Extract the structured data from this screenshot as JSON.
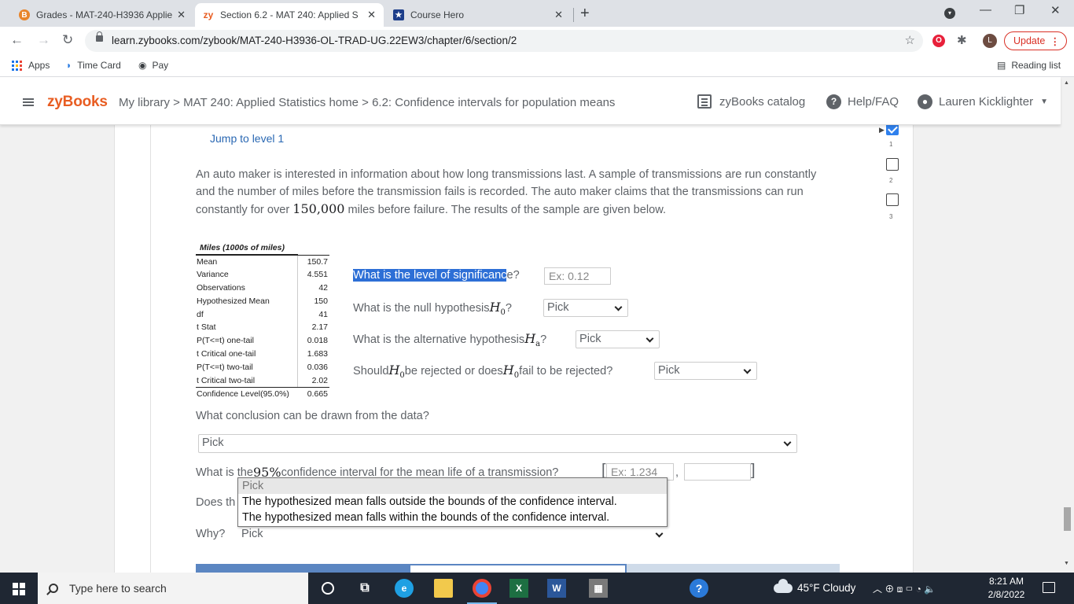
{
  "browser": {
    "tabs": [
      {
        "title": "Grades - MAT-240-H3936 Applie",
        "favicon": "B",
        "favicon_color": "#e8852b",
        "close": "✕"
      },
      {
        "title": "Section 6.2 - MAT 240: Applied S",
        "favicon": "zy",
        "favicon_color": "#e85d22",
        "close": "✕"
      },
      {
        "title": "Course Hero",
        "favicon": "★",
        "favicon_color": "#1d3e8a",
        "close": "✕"
      }
    ],
    "new_tab": "+",
    "url": "learn.zybooks.com/zybook/MAT-240-H3936-OL-TRAD-UG.22EW3/chapter/6/section/2",
    "profile_initial": "L",
    "update_label": "Update",
    "bookmarks": [
      {
        "label": "Apps"
      },
      {
        "label": "Time Card"
      },
      {
        "label": "Pay"
      }
    ],
    "reading_list": "Reading list"
  },
  "zybooks": {
    "logo": "zyBooks",
    "breadcrumb": "My library > MAT 240: Applied Statistics home > 6.2: Confidence intervals for population means",
    "catalog": "zyBooks catalog",
    "help": "Help/FAQ",
    "user": "Lauren Kicklighter"
  },
  "activity": {
    "jump_link": "Jump to level 1",
    "problem_text_1": "An auto maker is interested in information about how long transmissions last. A sample of transmissions are run constantly and the number of miles before the transmission fails is recorded. The auto maker claims that the transmissions can run constantly for over ",
    "problem_number": "150,000",
    "problem_text_2": " miles before failure. The results of the sample are given below.",
    "levels": [
      {
        "num": "1",
        "done": true
      },
      {
        "num": "2",
        "done": false
      },
      {
        "num": "3",
        "done": false
      }
    ],
    "table": {
      "header": "Miles (1000s of miles)",
      "rows": [
        {
          "k": "Mean",
          "v": "150.7"
        },
        {
          "k": "Variance",
          "v": "4.551"
        },
        {
          "k": "Observations",
          "v": "42"
        },
        {
          "k": "Hypothesized Mean",
          "v": "150"
        },
        {
          "k": "df",
          "v": "41"
        },
        {
          "k": "t Stat",
          "v": "2.17"
        },
        {
          "k": "P(T<=t) one-tail",
          "v": "0.018"
        },
        {
          "k": "t Critical one-tail",
          "v": "1.683"
        },
        {
          "k": "P(T<=t) two-tail",
          "v": "0.036"
        },
        {
          "k": "t Critical two-tail",
          "v": "2.02"
        },
        {
          "k": "Confidence Level(95.0%)",
          "v": "0.665"
        }
      ]
    },
    "q1_highlight": "What is the level of significanc",
    "q1_rest": "e?",
    "q1_placeholder": "Ex: 0.12",
    "q2_a": "What is the null hypothesis ",
    "q2_var": "H",
    "q2_sub": "0",
    "q2_end": "?",
    "q3_a": "What is the alternative hypothesis ",
    "q3_var": "H",
    "q3_sub": "a",
    "q3_end": "?",
    "q4_a": "Should ",
    "q4_b": " be rejected or does ",
    "q4_c": " fail to be rejected?",
    "q5": "What conclusion can be drawn from the data?",
    "q6_a": "What is the ",
    "q6_pct": "95%",
    "q6_b": " confidence interval for the mean life of a transmission?",
    "q6_placeholder": "Ex: 1.234",
    "q6_comma": ",",
    "q7": "Does th",
    "q8": "Why?",
    "pick": "Pick",
    "popup_options": [
      "Pick",
      "The hypothesized mean falls outside the bounds of the confidence interval.",
      "The hypothesized mean falls within the bounds of the confidence interval."
    ]
  },
  "taskbar": {
    "search_placeholder": "Type here to search",
    "weather": "45°F  Cloudy",
    "time": "8:21 AM",
    "date": "2/8/2022"
  }
}
